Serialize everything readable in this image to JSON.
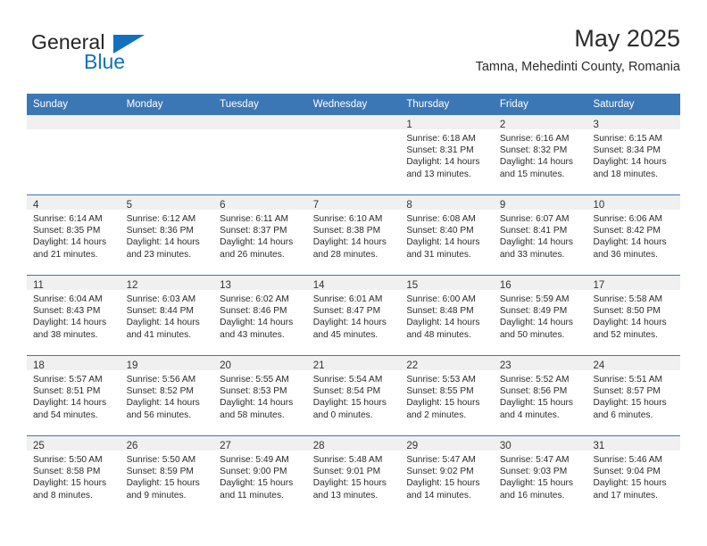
{
  "brand": {
    "name_part1": "General",
    "name_part2": "Blue",
    "triangle_color": "#1271bd"
  },
  "header": {
    "title": "May 2025",
    "subtitle": "Tamna, Mehedinti County, Romania"
  },
  "calendar": {
    "header_color": "#3b77b5",
    "weekdays": [
      "Sunday",
      "Monday",
      "Tuesday",
      "Wednesday",
      "Thursday",
      "Friday",
      "Saturday"
    ],
    "weeks": [
      [
        {
          "day": "",
          "sunrise": "",
          "sunset": "",
          "daylight": "",
          "empty": true
        },
        {
          "day": "",
          "sunrise": "",
          "sunset": "",
          "daylight": "",
          "empty": true
        },
        {
          "day": "",
          "sunrise": "",
          "sunset": "",
          "daylight": "",
          "empty": true
        },
        {
          "day": "",
          "sunrise": "",
          "sunset": "",
          "daylight": "",
          "empty": true
        },
        {
          "day": "1",
          "sunrise": "Sunrise: 6:18 AM",
          "sunset": "Sunset: 8:31 PM",
          "daylight": "Daylight: 14 hours and 13 minutes."
        },
        {
          "day": "2",
          "sunrise": "Sunrise: 6:16 AM",
          "sunset": "Sunset: 8:32 PM",
          "daylight": "Daylight: 14 hours and 15 minutes."
        },
        {
          "day": "3",
          "sunrise": "Sunrise: 6:15 AM",
          "sunset": "Sunset: 8:34 PM",
          "daylight": "Daylight: 14 hours and 18 minutes."
        }
      ],
      [
        {
          "day": "4",
          "sunrise": "Sunrise: 6:14 AM",
          "sunset": "Sunset: 8:35 PM",
          "daylight": "Daylight: 14 hours and 21 minutes."
        },
        {
          "day": "5",
          "sunrise": "Sunrise: 6:12 AM",
          "sunset": "Sunset: 8:36 PM",
          "daylight": "Daylight: 14 hours and 23 minutes."
        },
        {
          "day": "6",
          "sunrise": "Sunrise: 6:11 AM",
          "sunset": "Sunset: 8:37 PM",
          "daylight": "Daylight: 14 hours and 26 minutes."
        },
        {
          "day": "7",
          "sunrise": "Sunrise: 6:10 AM",
          "sunset": "Sunset: 8:38 PM",
          "daylight": "Daylight: 14 hours and 28 minutes."
        },
        {
          "day": "8",
          "sunrise": "Sunrise: 6:08 AM",
          "sunset": "Sunset: 8:40 PM",
          "daylight": "Daylight: 14 hours and 31 minutes."
        },
        {
          "day": "9",
          "sunrise": "Sunrise: 6:07 AM",
          "sunset": "Sunset: 8:41 PM",
          "daylight": "Daylight: 14 hours and 33 minutes."
        },
        {
          "day": "10",
          "sunrise": "Sunrise: 6:06 AM",
          "sunset": "Sunset: 8:42 PM",
          "daylight": "Daylight: 14 hours and 36 minutes."
        }
      ],
      [
        {
          "day": "11",
          "sunrise": "Sunrise: 6:04 AM",
          "sunset": "Sunset: 8:43 PM",
          "daylight": "Daylight: 14 hours and 38 minutes."
        },
        {
          "day": "12",
          "sunrise": "Sunrise: 6:03 AM",
          "sunset": "Sunset: 8:44 PM",
          "daylight": "Daylight: 14 hours and 41 minutes."
        },
        {
          "day": "13",
          "sunrise": "Sunrise: 6:02 AM",
          "sunset": "Sunset: 8:46 PM",
          "daylight": "Daylight: 14 hours and 43 minutes."
        },
        {
          "day": "14",
          "sunrise": "Sunrise: 6:01 AM",
          "sunset": "Sunset: 8:47 PM",
          "daylight": "Daylight: 14 hours and 45 minutes."
        },
        {
          "day": "15",
          "sunrise": "Sunrise: 6:00 AM",
          "sunset": "Sunset: 8:48 PM",
          "daylight": "Daylight: 14 hours and 48 minutes."
        },
        {
          "day": "16",
          "sunrise": "Sunrise: 5:59 AM",
          "sunset": "Sunset: 8:49 PM",
          "daylight": "Daylight: 14 hours and 50 minutes."
        },
        {
          "day": "17",
          "sunrise": "Sunrise: 5:58 AM",
          "sunset": "Sunset: 8:50 PM",
          "daylight": "Daylight: 14 hours and 52 minutes."
        }
      ],
      [
        {
          "day": "18",
          "sunrise": "Sunrise: 5:57 AM",
          "sunset": "Sunset: 8:51 PM",
          "daylight": "Daylight: 14 hours and 54 minutes."
        },
        {
          "day": "19",
          "sunrise": "Sunrise: 5:56 AM",
          "sunset": "Sunset: 8:52 PM",
          "daylight": "Daylight: 14 hours and 56 minutes."
        },
        {
          "day": "20",
          "sunrise": "Sunrise: 5:55 AM",
          "sunset": "Sunset: 8:53 PM",
          "daylight": "Daylight: 14 hours and 58 minutes."
        },
        {
          "day": "21",
          "sunrise": "Sunrise: 5:54 AM",
          "sunset": "Sunset: 8:54 PM",
          "daylight": "Daylight: 15 hours and 0 minutes."
        },
        {
          "day": "22",
          "sunrise": "Sunrise: 5:53 AM",
          "sunset": "Sunset: 8:55 PM",
          "daylight": "Daylight: 15 hours and 2 minutes."
        },
        {
          "day": "23",
          "sunrise": "Sunrise: 5:52 AM",
          "sunset": "Sunset: 8:56 PM",
          "daylight": "Daylight: 15 hours and 4 minutes."
        },
        {
          "day": "24",
          "sunrise": "Sunrise: 5:51 AM",
          "sunset": "Sunset: 8:57 PM",
          "daylight": "Daylight: 15 hours and 6 minutes."
        }
      ],
      [
        {
          "day": "25",
          "sunrise": "Sunrise: 5:50 AM",
          "sunset": "Sunset: 8:58 PM",
          "daylight": "Daylight: 15 hours and 8 minutes."
        },
        {
          "day": "26",
          "sunrise": "Sunrise: 5:50 AM",
          "sunset": "Sunset: 8:59 PM",
          "daylight": "Daylight: 15 hours and 9 minutes."
        },
        {
          "day": "27",
          "sunrise": "Sunrise: 5:49 AM",
          "sunset": "Sunset: 9:00 PM",
          "daylight": "Daylight: 15 hours and 11 minutes."
        },
        {
          "day": "28",
          "sunrise": "Sunrise: 5:48 AM",
          "sunset": "Sunset: 9:01 PM",
          "daylight": "Daylight: 15 hours and 13 minutes."
        },
        {
          "day": "29",
          "sunrise": "Sunrise: 5:47 AM",
          "sunset": "Sunset: 9:02 PM",
          "daylight": "Daylight: 15 hours and 14 minutes."
        },
        {
          "day": "30",
          "sunrise": "Sunrise: 5:47 AM",
          "sunset": "Sunset: 9:03 PM",
          "daylight": "Daylight: 15 hours and 16 minutes."
        },
        {
          "day": "31",
          "sunrise": "Sunrise: 5:46 AM",
          "sunset": "Sunset: 9:04 PM",
          "daylight": "Daylight: 15 hours and 17 minutes."
        }
      ]
    ]
  }
}
